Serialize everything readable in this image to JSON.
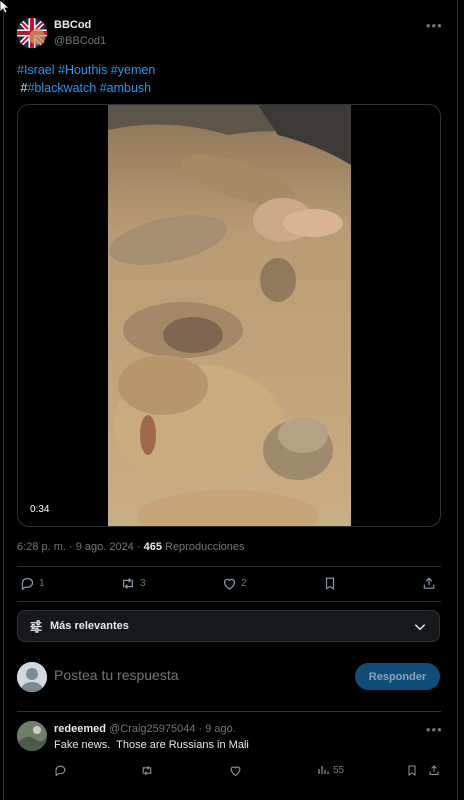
{
  "tweet": {
    "author_name": "BBCod",
    "author_handle": "@BBCod1",
    "hashtags_line1": "#Israel #Houthis #yemen",
    "hashtags_line2_prefix": "#",
    "hashtags_line2": "#blackwatch #ambush",
    "video_duration": "0:34",
    "timestamp": "6:28 p. m. · 9 ago. 2024 · ",
    "views_count": "465",
    "views_label": " Reproducciones",
    "replies": "1",
    "retweets": "3",
    "likes": "2"
  },
  "sort": {
    "label": "Más relevantes"
  },
  "reply_box": {
    "placeholder": "Postea tu respuesta",
    "button_label": "Responder"
  },
  "comment": {
    "name": "redeemed",
    "handle": "@Craig25975044 · 9 ago.",
    "text": "Fake news.  Those are Russians in Mali",
    "views": "55"
  },
  "icons": {
    "more": "more-horizontal-icon",
    "reply": "reply-icon",
    "retweet": "retweet-icon",
    "like": "heart-icon",
    "bookmark": "bookmark-icon",
    "share": "share-icon",
    "views": "views-icon",
    "sort": "sliders-icon",
    "chevron": "chevron-down-icon"
  },
  "colors": {
    "background": "#000000",
    "link": "#1d9bf0",
    "muted": "#71767b",
    "reply_button": "#0f4e78"
  }
}
